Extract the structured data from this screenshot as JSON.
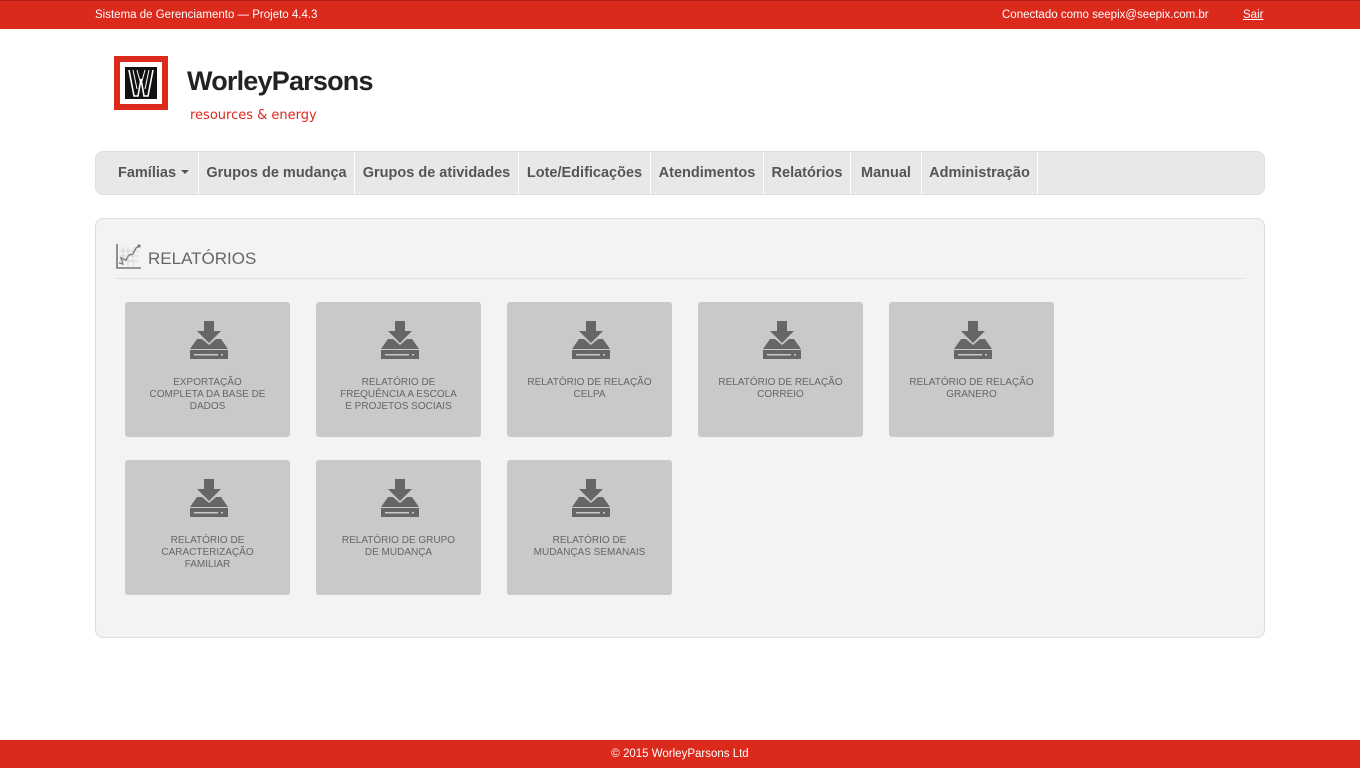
{
  "topbar": {
    "system": "Sistema de Gerenciamento — Projeto 4.4.3",
    "user": "Conectado como seepix@seepix.com.br",
    "logout": "Sair"
  },
  "brand": {
    "name": "WorleyParsons",
    "tagline": "resources & energy",
    "color": "#db291c"
  },
  "nav": {
    "items": [
      {
        "label": "Famílias",
        "dropdown": true
      },
      {
        "label": "Grupos de mudança"
      },
      {
        "label": "Grupos de atividades"
      },
      {
        "label": "Lote/Edificações"
      },
      {
        "label": "Atendimentos"
      },
      {
        "label": "Relatórios"
      },
      {
        "label": "Manual"
      },
      {
        "label": "Administração"
      }
    ]
  },
  "panel": {
    "title": "RELATÓRIOS",
    "icon": "chart-line-icon"
  },
  "reports": [
    {
      "label": "Exportação completa da base de dados",
      "icon": "download-icon"
    },
    {
      "label": "Relatório de frequência a escola e projetos sociais",
      "icon": "download-icon"
    },
    {
      "label": "Relatório de relação CELPA",
      "icon": "download-icon"
    },
    {
      "label": "Relatório de relação correio",
      "icon": "download-icon"
    },
    {
      "label": "Relatório de relação granero",
      "icon": "download-icon"
    },
    {
      "label": "Relatório de caracterização familiar",
      "icon": "download-icon"
    },
    {
      "label": "Relatório de grupo de mudança",
      "icon": "download-icon"
    },
    {
      "label": "Relatório de mudanças semanais",
      "icon": "download-icon"
    }
  ],
  "footer": {
    "text": "© 2015 WorleyParsons Ltd"
  }
}
